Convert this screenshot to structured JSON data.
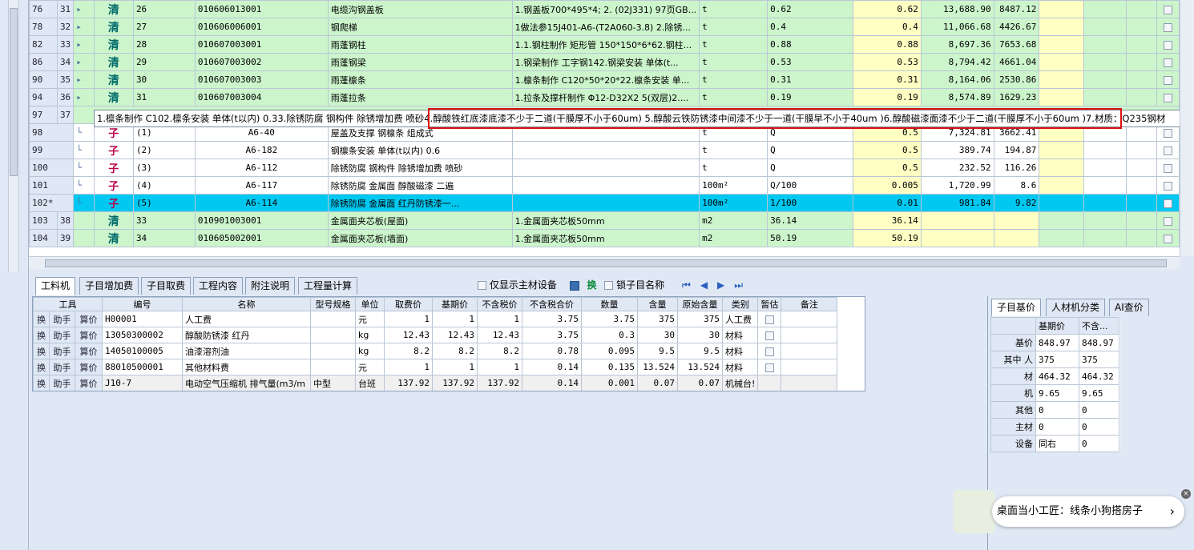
{
  "top_rows": [
    {
      "rn": "76",
      "rn2": "31",
      "type": "清",
      "idx": "26",
      "code": "010606013001",
      "name": "电缆沟钢盖板",
      "feat": "1.钢盖板700*495*4; 2. (02J331) 97页GB...",
      "unit": "t",
      "qty": "0.62",
      "qty2": "0.62",
      "price": "13,688.90",
      "total": "8487.12"
    },
    {
      "rn": "78",
      "rn2": "32",
      "type": "清",
      "idx": "27",
      "code": "010606006001",
      "name": "钢爬梯",
      "feat": "1做法参15J401-A6-(T2A060-3.8) 2.除锈...",
      "unit": "t",
      "qty": "0.4",
      "qty2": "0.4",
      "price": "11,066.68",
      "total": "4426.67"
    },
    {
      "rn": "82",
      "rn2": "33",
      "type": "清",
      "idx": "28",
      "code": "010607003001",
      "name": "雨蓬钢柱",
      "feat": "1.1.钢柱制作 矩形管 150*150*6*62.钢柱...",
      "unit": "t",
      "qty": "0.88",
      "qty2": "0.88",
      "price": "8,697.36",
      "total": "7653.68"
    },
    {
      "rn": "86",
      "rn2": "34",
      "type": "清",
      "idx": "29",
      "code": "010607003002",
      "name": "雨蓬钢梁",
      "feat": "1.钢梁制作 工字钢142.钢梁安装 单体(t...",
      "unit": "t",
      "qty": "0.53",
      "qty2": "0.53",
      "price": "8,794.42",
      "total": "4661.04"
    },
    {
      "rn": "90",
      "rn2": "35",
      "type": "清",
      "idx": "30",
      "code": "010607003003",
      "name": "雨蓬檩条",
      "feat": "1.檩条制作 C120*50*20*22.檩条安装 单...",
      "unit": "t",
      "qty": "0.31",
      "qty2": "0.31",
      "price": "8,164.06",
      "total": "2530.86"
    },
    {
      "rn": "94",
      "rn2": "36",
      "type": "清",
      "idx": "31",
      "code": "010607003004",
      "name": "雨蓬拉条",
      "feat": "1.拉条及撑杆制作 Φ12-D32X2 5(双层)2....",
      "unit": "t",
      "qty": "0.19",
      "qty2": "0.19",
      "price": "8,574.89",
      "total": "1629.23"
    }
  ],
  "tip_row": {
    "rn": "97",
    "rn2": "37",
    "text": "1.檩条制作 C102.檩条安装 单体(t以内) 0.33.除锈防腐 钢构件 除锈增加费 喷砂4.醇酸铁红底漆底漆不少于二道(干膜厚不小于60um) 5.醇酸云铁防锈漆中间漆不少于一道(干膜早不小于40um )6.醇酸磁漆面漆不少于二道(干膜厚不小于60um )7.材质：Q235钢材"
  },
  "sub_rows": [
    {
      "rn": "98",
      "type": "子",
      "idx": "(1)",
      "code": "A6-40",
      "name": "屋盖及支撑 钢檩条 组成式",
      "unit": "t",
      "qty": "Q",
      "qty2": "0.5",
      "price": "7,324.81",
      "total": "3662.41",
      "sel": false
    },
    {
      "rn": "99",
      "type": "子",
      "idx": "(2)",
      "code": "A6-182",
      "name": "钢檩条安装 单体(t以内) 0.6",
      "unit": "t",
      "qty": "Q",
      "qty2": "0.5",
      "price": "389.74",
      "total": "194.87",
      "sel": false
    },
    {
      "rn": "100",
      "type": "子",
      "idx": "(3)",
      "code": "A6-112",
      "name": "除锈防腐 钢构件 除锈增加费 喷砂",
      "unit": "t",
      "qty": "Q",
      "qty2": "0.5",
      "price": "232.52",
      "total": "116.26",
      "sel": false
    },
    {
      "rn": "101",
      "type": "子",
      "idx": "(4)",
      "code": "A6-117",
      "name": "除锈防腐 金属面 醇酸磁漆 二遍",
      "unit": "100m²",
      "qty": "Q/100",
      "qty2": "0.005",
      "price": "1,720.99",
      "total": "8.6",
      "sel": false
    },
    {
      "rn": "102*",
      "type": "子",
      "idx": "(5)",
      "code": "A6-114",
      "name": "除锈防腐 金属面 红丹防锈漆一...",
      "unit": "100m²",
      "qty": "1/100",
      "qty2": "0.01",
      "price": "981.84",
      "total": "9.82",
      "sel": true
    }
  ],
  "tail_rows": [
    {
      "rn": "103",
      "rn2": "38",
      "type": "清",
      "idx": "33",
      "code": "010901003001",
      "name": "金属面夹芯板(屋面)",
      "feat": "1.金属面夹芯板50mm",
      "unit": "m2",
      "qty": "36.14",
      "qty2": "36.14"
    },
    {
      "rn": "104",
      "rn2": "39",
      "type": "清",
      "idx": "34",
      "code": "010605002001",
      "name": "金属面夹芯板(墙面)",
      "feat": "1.金属面夹芯板50mm",
      "unit": "m2",
      "qty": "50.19",
      "qty2": "50.19"
    }
  ],
  "tabs": [
    "工料机",
    "子目增加费",
    "子目取费",
    "工程内容",
    "附注说明",
    "工程量计算"
  ],
  "toolbar": {
    "only_main": "仅显示主材设备",
    "swap": "换",
    "lock_name": "锁子目名称"
  },
  "bottom_headers": [
    "工具",
    "编号",
    "名称",
    "型号规格",
    "单位",
    "取费价",
    "基期价",
    "不含税价",
    "不含税合价",
    "数量",
    "含量",
    "原始含量",
    "类别",
    "暂估",
    "备注"
  ],
  "bottom_rows": [
    {
      "t1": "换",
      "t2": "助手",
      "t3": "算价",
      "code": "H00001",
      "name": "人工费",
      "spec": "",
      "unit": "元",
      "p1": "1",
      "p2": "1",
      "p3": "1",
      "p4": "3.75",
      "num": "3.75",
      "hl": "375",
      "ohl": "375",
      "cat": "人工费"
    },
    {
      "t1": "换",
      "t2": "助手",
      "t3": "算价",
      "code": "13050300002",
      "name": "醇酸防锈漆 红丹",
      "spec": "",
      "unit": "kg",
      "p1": "12.43",
      "p2": "12.43",
      "p3": "12.43",
      "p4": "3.75",
      "num": "0.3",
      "hl": "30",
      "ohl": "30",
      "cat": "材料"
    },
    {
      "t1": "换",
      "t2": "助手",
      "t3": "算价",
      "code": "14050100005",
      "name": "油漆溶剂油",
      "spec": "",
      "unit": "kg",
      "p1": "8.2",
      "p2": "8.2",
      "p3": "8.2",
      "p4": "0.78",
      "num": "0.095",
      "hl": "9.5",
      "ohl": "9.5",
      "cat": "材料"
    },
    {
      "t1": "换",
      "t2": "助手",
      "t3": "算价",
      "code": "88010500001",
      "name": "其他材料费",
      "spec": "",
      "unit": "元",
      "p1": "1",
      "p2": "1",
      "p3": "1",
      "p4": "0.14",
      "num": "0.135",
      "hl": "13.524",
      "ohl": "13.524",
      "cat": "材料"
    },
    {
      "t1": "换",
      "t2": "助手",
      "t3": "算价",
      "code": "J10-7",
      "name": "电动空气压缩机 排气量(m3/m",
      "spec": "中型",
      "unit": "台班",
      "p1": "137.92",
      "p2": "137.92",
      "p3": "137.92",
      "p4": "0.14",
      "num": "0.001",
      "hl": "0.07",
      "ohl": "0.07",
      "cat": "机械台!"
    }
  ],
  "right_tabs": [
    "子目基价",
    "人材机分类",
    "AI查价"
  ],
  "right_headers": [
    "",
    "基期价",
    "不含..."
  ],
  "right_rows": [
    {
      "label": "基价",
      "v1": "848.97",
      "v2": "848.97"
    },
    {
      "label": "其中 人",
      "v1": "375",
      "v2": "375"
    },
    {
      "label": "材",
      "v1": "464.32",
      "v2": "464.32"
    },
    {
      "label": "机",
      "v1": "9.65",
      "v2": "9.65"
    },
    {
      "label": "其他",
      "v1": "0",
      "v2": "0"
    },
    {
      "label": "主材",
      "v1": "0",
      "v2": "0"
    },
    {
      "label": "设备",
      "v1": "同右",
      "v2": "0"
    }
  ],
  "notification": {
    "text": "桌面当小工匠：线条小狗搭房子",
    "arrow": "›"
  }
}
